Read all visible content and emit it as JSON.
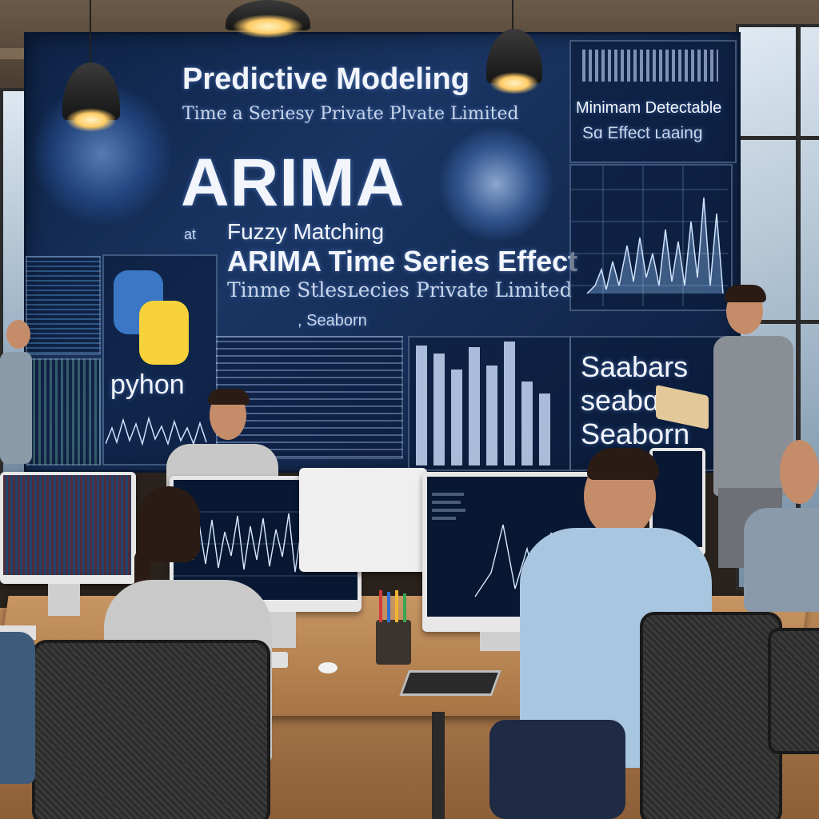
{
  "board": {
    "title": "Predictive Modeling",
    "subtitle": "Time a Seriesy Private Plvate Limited",
    "big_word": "ARIMA",
    "at": "at",
    "fuzzy": "Fuzzy Matching",
    "arima_line": "ARIMA Time Series Effect",
    "time_line": "Tinme Stlesʟecies Private Limited",
    "seaborn_small": ", Seaborn",
    "mde_line1": "Minimam Detectable",
    "mde_line2": "Sɑ Effect ʟaaing",
    "python_label": "pyhon",
    "right_words": [
      "Saabars",
      "seabɑrn",
      "Seaborn"
    ]
  },
  "colors": {
    "board_bg": "#0e2346",
    "accent_blue": "#7fb3ff",
    "python_blue": "#3b77c4",
    "python_yellow": "#f7d23b"
  }
}
